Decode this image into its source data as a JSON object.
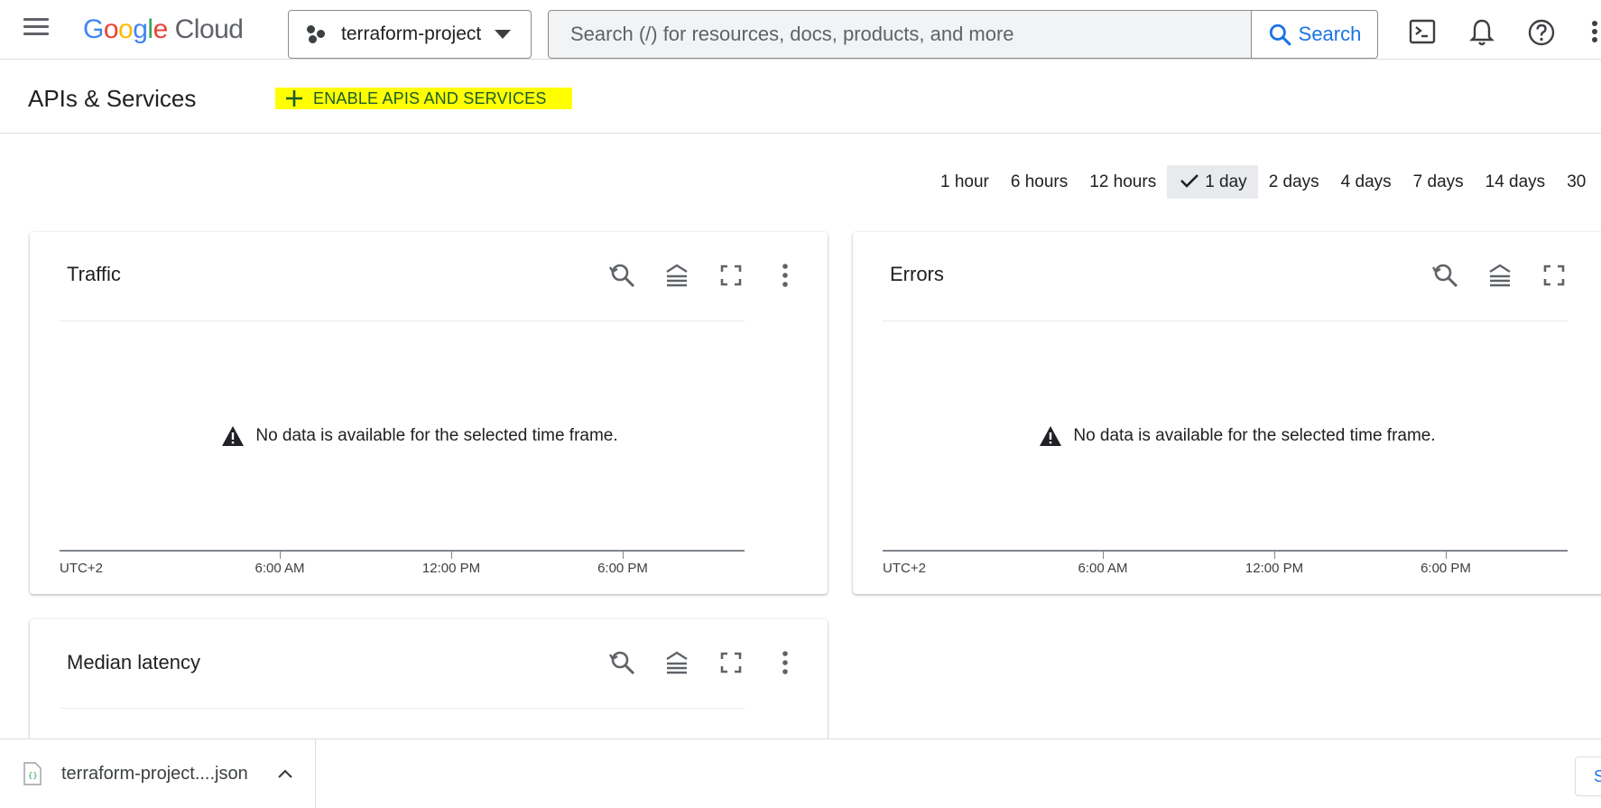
{
  "header": {
    "logo_google": "Google",
    "logo_cloud": "Cloud",
    "project_name": "terraform-project",
    "search_placeholder": "Search (/) for resources, docs, products, and more",
    "search_button": "Search"
  },
  "subheader": {
    "title": "APIs & Services",
    "enable_button": "ENABLE APIS AND SERVICES"
  },
  "time_range": {
    "options": [
      "1 hour",
      "6 hours",
      "12 hours",
      "1 day",
      "2 days",
      "4 days",
      "7 days",
      "14 days",
      "30"
    ],
    "selected": "1 day"
  },
  "cards": [
    {
      "title": "Traffic",
      "message": "No data is available for the selected time frame.",
      "timezone": "UTC+2",
      "ticks": [
        "6:00 AM",
        "12:00 PM",
        "6:00 PM"
      ]
    },
    {
      "title": "Errors",
      "message": "No data is available for the selected time frame.",
      "timezone": "UTC+2",
      "ticks": [
        "6:00 AM",
        "12:00 PM",
        "6:00 PM"
      ]
    },
    {
      "title": "Median latency"
    }
  ],
  "download_bar": {
    "file_name": "terraform-project....json",
    "show_all": "S"
  },
  "colors": {
    "accent": "#1a73e8",
    "highlight": "#ffff00",
    "icon": "#5f6368"
  },
  "icons": {
    "menu": "hamburger-menu-icon",
    "terminal": "cloud-shell-icon",
    "notifications": "bell-icon",
    "help": "help-icon",
    "more": "more-vert-icon"
  }
}
